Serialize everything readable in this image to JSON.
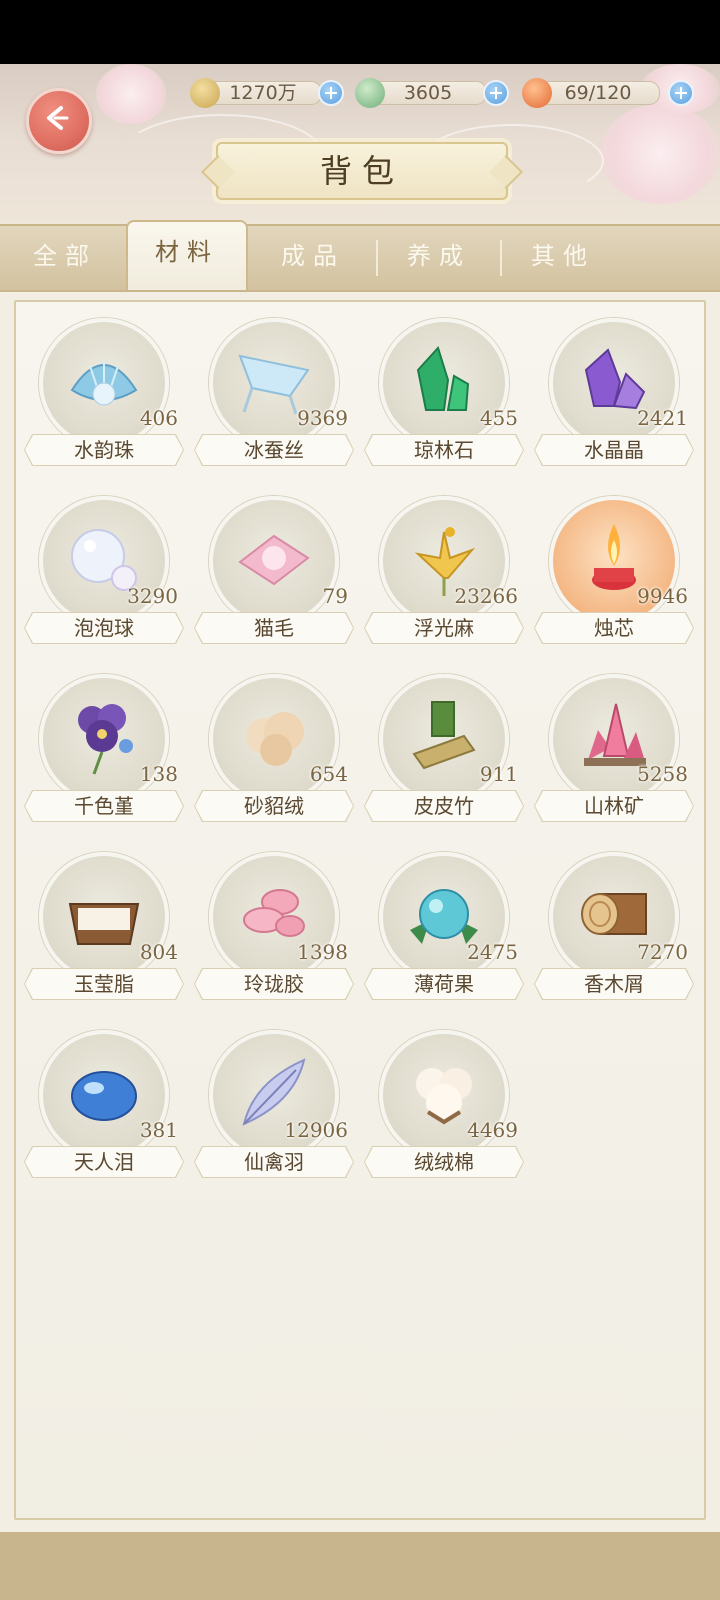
{
  "header": {
    "title": "背包",
    "resources": [
      {
        "name": "coin-icon",
        "value": "1270万",
        "color": "#d6b76a"
      },
      {
        "name": "jade-leaf-icon",
        "value": "3605",
        "color": "#7fbf8d"
      },
      {
        "name": "stamina-food-icon",
        "value": "69/120",
        "color": "#ee8a55"
      }
    ]
  },
  "tabs": [
    {
      "label": "全部",
      "active": false
    },
    {
      "label": "材料",
      "active": true
    },
    {
      "label": "成品",
      "active": false
    },
    {
      "label": "养成",
      "active": false
    },
    {
      "label": "其他",
      "active": false
    }
  ],
  "items": [
    {
      "name": "水韵珠",
      "count": "406",
      "icon": "pearl-shell-icon"
    },
    {
      "name": "冰蚕丝",
      "count": "9369",
      "icon": "ice-silk-icon"
    },
    {
      "name": "琼林石",
      "count": "455",
      "icon": "green-crystal-icon"
    },
    {
      "name": "水晶晶",
      "count": "2421",
      "icon": "purple-crystal-icon"
    },
    {
      "name": "泡泡球",
      "count": "3290",
      "icon": "bubble-icon"
    },
    {
      "name": "猫毛",
      "count": "79",
      "icon": "cat-fur-icon"
    },
    {
      "name": "浮光麻",
      "count": "23266",
      "icon": "golden-flower-icon"
    },
    {
      "name": "烛芯",
      "count": "9946",
      "icon": "candle-icon",
      "highlight": true
    },
    {
      "name": "千色堇",
      "count": "138",
      "icon": "pansy-icon"
    },
    {
      "name": "砂貂绒",
      "count": "654",
      "icon": "fluff-icon"
    },
    {
      "name": "皮皮竹",
      "count": "911",
      "icon": "bamboo-icon"
    },
    {
      "name": "山林矿",
      "count": "5258",
      "icon": "pink-ore-icon"
    },
    {
      "name": "玉莹脂",
      "count": "804",
      "icon": "jade-paste-icon"
    },
    {
      "name": "玲珑胶",
      "count": "1398",
      "icon": "pink-gel-icon"
    },
    {
      "name": "薄荷果",
      "count": "2475",
      "icon": "mint-fruit-icon"
    },
    {
      "name": "香木屑",
      "count": "7270",
      "icon": "wood-log-icon"
    },
    {
      "name": "天人泪",
      "count": "381",
      "icon": "blue-tear-icon"
    },
    {
      "name": "仙禽羽",
      "count": "12906",
      "icon": "feather-icon"
    },
    {
      "name": "绒绒棉",
      "count": "4469",
      "icon": "cotton-icon"
    }
  ]
}
